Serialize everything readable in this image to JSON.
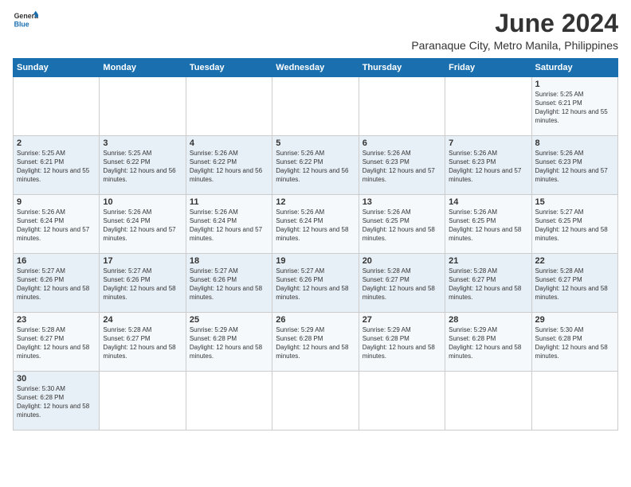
{
  "header": {
    "logo_general": "General",
    "logo_blue": "Blue",
    "month_title": "June 2024",
    "subtitle": "Paranaque City, Metro Manila, Philippines"
  },
  "days_of_week": [
    "Sunday",
    "Monday",
    "Tuesday",
    "Wednesday",
    "Thursday",
    "Friday",
    "Saturday"
  ],
  "weeks": [
    [
      {
        "day": "",
        "info": ""
      },
      {
        "day": "",
        "info": ""
      },
      {
        "day": "",
        "info": ""
      },
      {
        "day": "",
        "info": ""
      },
      {
        "day": "",
        "info": ""
      },
      {
        "day": "",
        "info": ""
      },
      {
        "day": "1",
        "info": "Sunrise: 5:25 AM\nSunset: 6:21 PM\nDaylight: 12 hours and 55 minutes."
      }
    ],
    [
      {
        "day": "2",
        "info": "Sunrise: 5:25 AM\nSunset: 6:21 PM\nDaylight: 12 hours and 55 minutes."
      },
      {
        "day": "3",
        "info": "Sunrise: 5:25 AM\nSunset: 6:22 PM\nDaylight: 12 hours and 56 minutes."
      },
      {
        "day": "4",
        "info": "Sunrise: 5:26 AM\nSunset: 6:22 PM\nDaylight: 12 hours and 56 minutes."
      },
      {
        "day": "5",
        "info": "Sunrise: 5:26 AM\nSunset: 6:22 PM\nDaylight: 12 hours and 56 minutes."
      },
      {
        "day": "6",
        "info": "Sunrise: 5:26 AM\nSunset: 6:23 PM\nDaylight: 12 hours and 57 minutes."
      },
      {
        "day": "7",
        "info": "Sunrise: 5:26 AM\nSunset: 6:23 PM\nDaylight: 12 hours and 57 minutes."
      },
      {
        "day": "8",
        "info": "Sunrise: 5:26 AM\nSunset: 6:23 PM\nDaylight: 12 hours and 57 minutes."
      }
    ],
    [
      {
        "day": "9",
        "info": "Sunrise: 5:26 AM\nSunset: 6:24 PM\nDaylight: 12 hours and 57 minutes."
      },
      {
        "day": "10",
        "info": "Sunrise: 5:26 AM\nSunset: 6:24 PM\nDaylight: 12 hours and 57 minutes."
      },
      {
        "day": "11",
        "info": "Sunrise: 5:26 AM\nSunset: 6:24 PM\nDaylight: 12 hours and 57 minutes."
      },
      {
        "day": "12",
        "info": "Sunrise: 5:26 AM\nSunset: 6:24 PM\nDaylight: 12 hours and 58 minutes."
      },
      {
        "day": "13",
        "info": "Sunrise: 5:26 AM\nSunset: 6:25 PM\nDaylight: 12 hours and 58 minutes."
      },
      {
        "day": "14",
        "info": "Sunrise: 5:26 AM\nSunset: 6:25 PM\nDaylight: 12 hours and 58 minutes."
      },
      {
        "day": "15",
        "info": "Sunrise: 5:27 AM\nSunset: 6:25 PM\nDaylight: 12 hours and 58 minutes."
      }
    ],
    [
      {
        "day": "16",
        "info": "Sunrise: 5:27 AM\nSunset: 6:26 PM\nDaylight: 12 hours and 58 minutes."
      },
      {
        "day": "17",
        "info": "Sunrise: 5:27 AM\nSunset: 6:26 PM\nDaylight: 12 hours and 58 minutes."
      },
      {
        "day": "18",
        "info": "Sunrise: 5:27 AM\nSunset: 6:26 PM\nDaylight: 12 hours and 58 minutes."
      },
      {
        "day": "19",
        "info": "Sunrise: 5:27 AM\nSunset: 6:26 PM\nDaylight: 12 hours and 58 minutes."
      },
      {
        "day": "20",
        "info": "Sunrise: 5:28 AM\nSunset: 6:27 PM\nDaylight: 12 hours and 58 minutes."
      },
      {
        "day": "21",
        "info": "Sunrise: 5:28 AM\nSunset: 6:27 PM\nDaylight: 12 hours and 58 minutes."
      },
      {
        "day": "22",
        "info": "Sunrise: 5:28 AM\nSunset: 6:27 PM\nDaylight: 12 hours and 58 minutes."
      }
    ],
    [
      {
        "day": "23",
        "info": "Sunrise: 5:28 AM\nSunset: 6:27 PM\nDaylight: 12 hours and 58 minutes."
      },
      {
        "day": "24",
        "info": "Sunrise: 5:28 AM\nSunset: 6:27 PM\nDaylight: 12 hours and 58 minutes."
      },
      {
        "day": "25",
        "info": "Sunrise: 5:29 AM\nSunset: 6:28 PM\nDaylight: 12 hours and 58 minutes."
      },
      {
        "day": "26",
        "info": "Sunrise: 5:29 AM\nSunset: 6:28 PM\nDaylight: 12 hours and 58 minutes."
      },
      {
        "day": "27",
        "info": "Sunrise: 5:29 AM\nSunset: 6:28 PM\nDaylight: 12 hours and 58 minutes."
      },
      {
        "day": "28",
        "info": "Sunrise: 5:29 AM\nSunset: 6:28 PM\nDaylight: 12 hours and 58 minutes."
      },
      {
        "day": "29",
        "info": "Sunrise: 5:30 AM\nSunset: 6:28 PM\nDaylight: 12 hours and 58 minutes."
      }
    ],
    [
      {
        "day": "30",
        "info": "Sunrise: 5:30 AM\nSunset: 6:28 PM\nDaylight: 12 hours and 58 minutes."
      },
      {
        "day": "",
        "info": ""
      },
      {
        "day": "",
        "info": ""
      },
      {
        "day": "",
        "info": ""
      },
      {
        "day": "",
        "info": ""
      },
      {
        "day": "",
        "info": ""
      },
      {
        "day": "",
        "info": ""
      }
    ]
  ]
}
